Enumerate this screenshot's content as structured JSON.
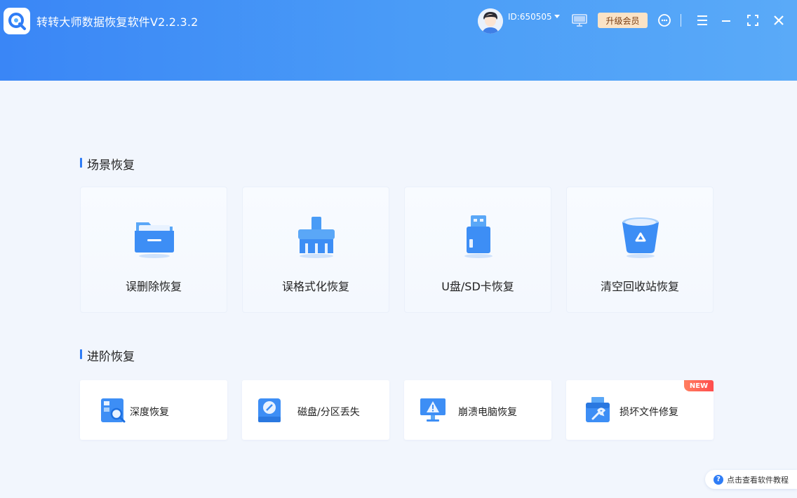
{
  "header": {
    "app_title": "转转大师数据恢复软件V2.2.3.2",
    "user_id": "ID:650505",
    "upgrade_label": "升级会员"
  },
  "colors": {
    "header_gradient_start": "#3a86f6",
    "header_gradient_end": "#5aaaf8",
    "accent": "#2f7df6",
    "upgrade_bg": "#fbe3c6",
    "new_badge": "#ff5a4f"
  },
  "scene_section": {
    "title": "场景恢复",
    "cards": [
      {
        "label": "误删除恢复",
        "icon": "folder-icon"
      },
      {
        "label": "误格式化恢复",
        "icon": "broom-icon"
      },
      {
        "label": "U盘/SD卡恢复",
        "icon": "usb-drive-icon"
      },
      {
        "label": "清空回收站恢复",
        "icon": "recycle-bin-icon"
      }
    ]
  },
  "advanced_section": {
    "title": "进阶恢复",
    "cards": [
      {
        "label": "深度恢复",
        "icon": "deep-scan-icon"
      },
      {
        "label": "磁盘/分区丢失",
        "icon": "disk-icon"
      },
      {
        "label": "崩溃电脑恢复",
        "icon": "crashed-computer-icon"
      },
      {
        "label": "损坏文件修复",
        "icon": "file-repair-icon",
        "badge": "NEW"
      }
    ]
  },
  "tutorial_link": "点击查看软件教程"
}
